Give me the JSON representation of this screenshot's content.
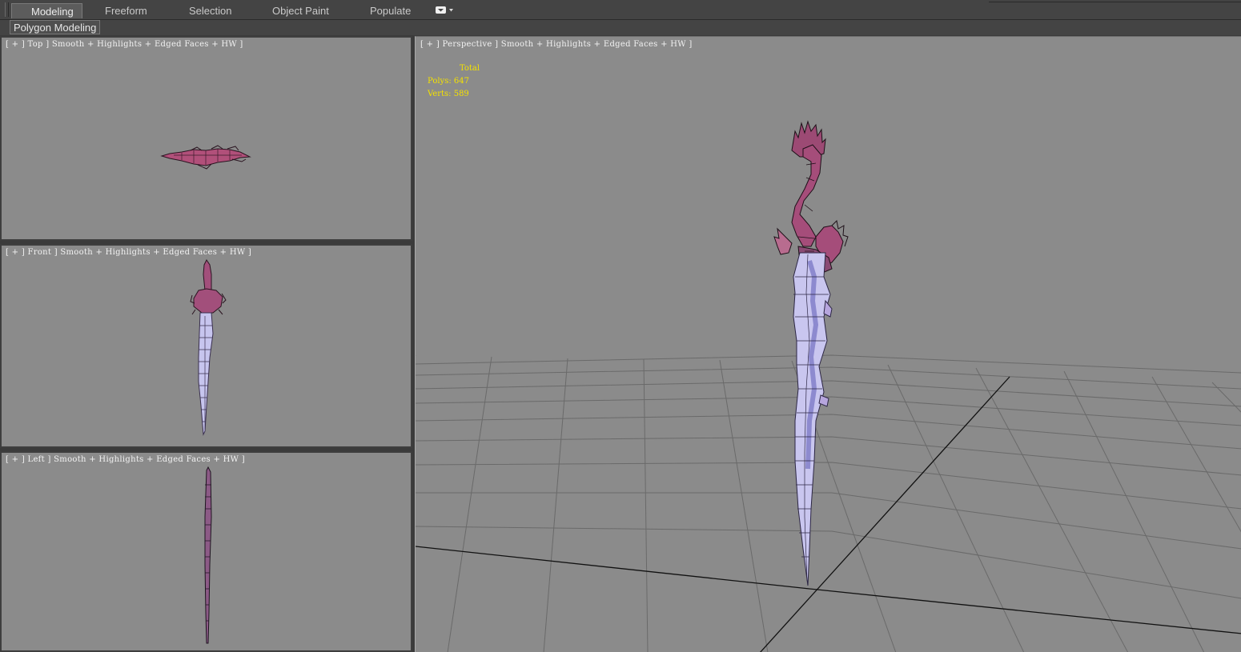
{
  "ribbon": {
    "tabs": [
      "Modeling",
      "Freeform",
      "Selection",
      "Object Paint",
      "Populate"
    ],
    "active_tab": "Modeling",
    "sub_tab": "Polygon Modeling"
  },
  "viewports": {
    "top": {
      "label": "[ + ] Top ] Smooth + Highlights + Edged Faces + HW ]"
    },
    "front": {
      "label": "[ + ] Front ] Smooth + Highlights + Edged Faces + HW ]"
    },
    "left": {
      "label": "[ + ] Left ] Smooth + Highlights + Edged Faces + HW ]"
    },
    "perspective": {
      "label": "[ + ] Perspective ] Smooth + Highlights + Edged Faces + HW ]",
      "stats": {
        "header": "Total",
        "polys": "Polys: 647",
        "verts": "Verts: 589"
      }
    }
  },
  "colors": {
    "viewport_bg": "#8b8b8b",
    "label_text": "#f2f2f2",
    "stats_text": "#f4e200",
    "active_tab_bg": "#5c5c5c"
  },
  "icons": [
    "workspace-dropdown-icon",
    "ribbon-grip-icon"
  ]
}
